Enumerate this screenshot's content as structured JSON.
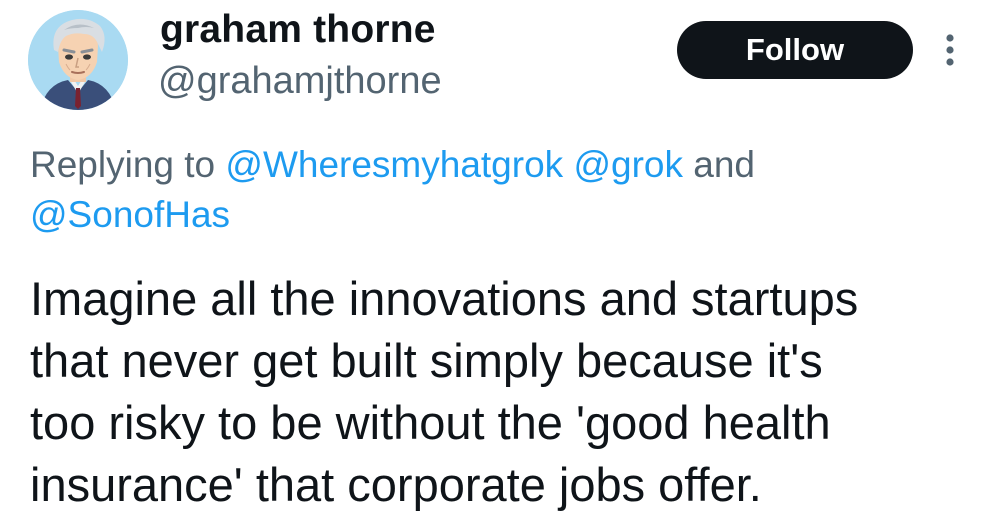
{
  "user": {
    "display_name": "graham thorne",
    "handle": "@grahamjthorne",
    "avatar_icon": "anime-portrait-avatar"
  },
  "actions": {
    "follow_label": "Follow",
    "more_icon": "more-vertical-icon"
  },
  "reply": {
    "prefix": "Replying to",
    "mentions": [
      "@Wheresmyhatgrok",
      "@grok",
      "@SonofHas"
    ],
    "conjunction": "and"
  },
  "tweet": {
    "lines": [
      "Imagine all the innovations and startups",
      "that never get built simply because it's",
      "too risky to be without the 'good health",
      "insurance' that corporate jobs offer."
    ]
  },
  "colors": {
    "text": "#0f1419",
    "secondary": "#536471",
    "link": "#1d9bf0",
    "button_bg": "#0f1419",
    "button_text": "#ffffff"
  }
}
